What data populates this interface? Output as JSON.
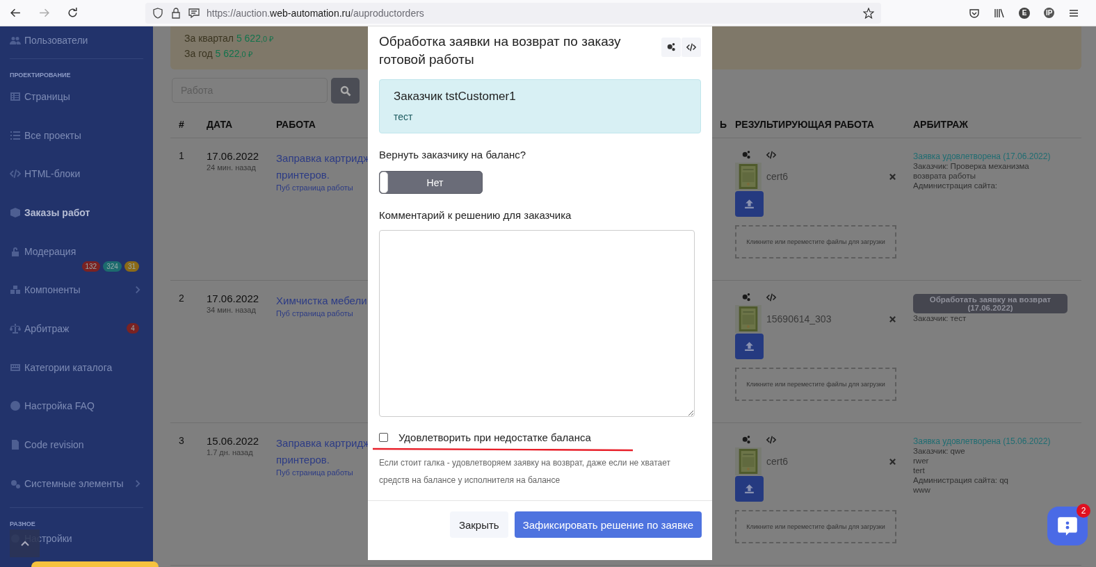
{
  "browser": {
    "url": {
      "scheme": "https://auction.",
      "domain": "web-automation.ru",
      "path": "/auproductorders"
    },
    "profile_initial": "E",
    "extension_label": "IP"
  },
  "sidebar": {
    "sections": [
      {
        "items": [
          {
            "label": "Пользователи",
            "selected": false,
            "expandable": false
          }
        ]
      },
      {
        "heading": "ПРОЕКТИРОВАНИЕ",
        "items": [
          {
            "label": "Страницы",
            "selected": false,
            "expandable": false
          },
          {
            "label": "Все проекты",
            "selected": false,
            "expandable": false
          },
          {
            "label": "HTML-блоки",
            "selected": false,
            "expandable": false
          },
          {
            "label": "Заказы работ",
            "selected": true,
            "expandable": false
          },
          {
            "label": "Модерация",
            "selected": false,
            "expandable": false,
            "badges": [
              {
                "text": "132",
                "color": "#7a2222"
              },
              {
                "text": "324",
                "color": "#1c6b6e"
              },
              {
                "text": "31",
                "color": "#8a6a18"
              }
            ]
          },
          {
            "label": "Компоненты",
            "selected": false,
            "expandable": true
          },
          {
            "label": "Арбитраж",
            "selected": false,
            "expandable": false,
            "badges": [
              {
                "text": "4",
                "color": "#7a2222"
              }
            ]
          },
          {
            "label": "Категории каталога",
            "selected": false,
            "expandable": false
          },
          {
            "label": "Настройка FAQ",
            "selected": false,
            "expandable": false
          },
          {
            "label": "Code revision",
            "selected": false,
            "expandable": false
          },
          {
            "label": "Системные элементы",
            "selected": false,
            "expandable": true
          }
        ]
      },
      {
        "heading": "РАЗНОЕ",
        "items": [
          {
            "label": "Настройки",
            "selected": false,
            "expandable": false
          }
        ]
      }
    ]
  },
  "summary": [
    {
      "label": "За квартал",
      "amount": "5 622",
      "fraction": ",0 ₽"
    },
    {
      "label": "За год",
      "amount": "5 622",
      "fraction": ",0 ₽"
    }
  ],
  "search": {
    "placeholder": "Работа"
  },
  "table": {
    "columns": [
      "#",
      "ДАТА",
      "РАБОТА",
      "Ь",
      "РЕЗУЛЬТИРУЮЩАЯ РАБОТА",
      "АРБИТРАЖ"
    ],
    "rows": [
      {
        "num": "1",
        "date": "17.06.2022",
        "ago": "24 мин. назад",
        "work": "Заправка картридж принтеров.",
        "pub_link": "Пуб страница работы",
        "file": "cert6",
        "dropzone": "Кликните или переместите файлы для загрузки",
        "arbitration": {
          "kind": "status",
          "status": "Заявка удовлетворена (17.06.2022)",
          "lines": [
            "Заказчик: Проверка механизма возврата работы",
            "Администрация сайта:"
          ]
        }
      },
      {
        "num": "2",
        "date": "17.06.2022",
        "ago": "34 мин. назад",
        "work": "Химчистка мебели",
        "pub_link": "Пуб страница работы",
        "file": "15690614_303",
        "dropzone": "Кликните или переместите файлы для загрузки",
        "arbitration": {
          "kind": "button",
          "status": "Обработать заявку на возврат (17.06.2022)",
          "lines": [
            "Заказчик: тест"
          ]
        }
      },
      {
        "num": "3",
        "date": "15.06.2022",
        "ago": "1.7 дн. назад",
        "work": "Заправка картридж принтеров.",
        "pub_link": "Пуб страница работы",
        "file": "cert6",
        "dropzone": "Кликните или переместите файлы для загрузки",
        "arbitration": {
          "kind": "status",
          "status": "Заявка удовлетворена (15.06.2022)",
          "lines": [
            "Заказчик: qwe",
            "rwer",
            "tert",
            "Администрация сайта: qq",
            "www"
          ]
        }
      }
    ]
  },
  "modal": {
    "title": "Обработка заявки на возврат по заказу готовой работы",
    "alert": {
      "title": "Заказчик tstCustomer1",
      "text": "тест"
    },
    "refund": {
      "label": "Вернуть заказчику на баланс?",
      "on": false,
      "text": "Нет"
    },
    "comment": {
      "label": "Комментарий к решению для заказчика"
    },
    "force": {
      "label": "Удовлетворить при недостатке баланса",
      "checked": false
    },
    "help": "Если стоит галка - удовлетворяем заявку на возврат, даже если не хватает средств на балансе у исполнителя на балансе",
    "buttons": {
      "close": "Закрыть",
      "submit": "Зафиксировать решение по заявке"
    }
  },
  "chat": {
    "badge": "2"
  }
}
